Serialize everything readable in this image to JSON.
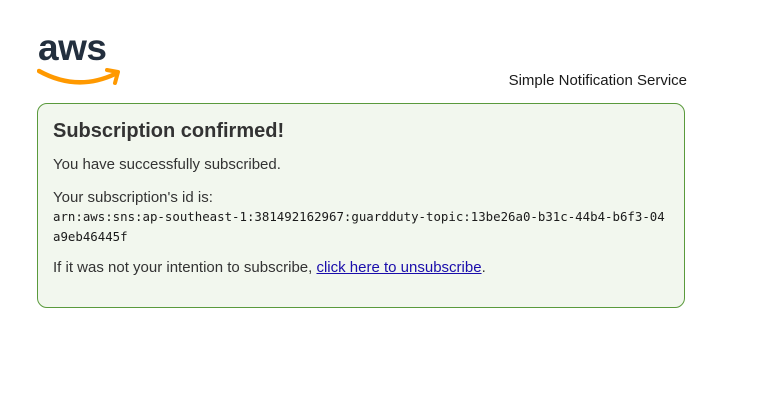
{
  "header": {
    "logo_text": "aws",
    "service_name": "Simple Notification Service"
  },
  "confirmation": {
    "title": "Subscription confirmed!",
    "success_message": "You have successfully subscribed.",
    "id_label": "Your subscription's id is:",
    "subscription_arn": "arn:aws:sns:ap-southeast-1:381492162967:guardduty-topic:13be26a0-b31c-44b4-b6f3-04a9eb46445f",
    "unsubscribe_prefix": "If it was not your intention to subscribe, ",
    "unsubscribe_link": "click here to unsubscribe",
    "unsubscribe_suffix": "."
  },
  "colors": {
    "box_border": "#5a9a3c",
    "box_background": "#f2f7ee",
    "link": "#1a0dab",
    "aws_smile": "#ff9900",
    "aws_text": "#232f3e"
  }
}
